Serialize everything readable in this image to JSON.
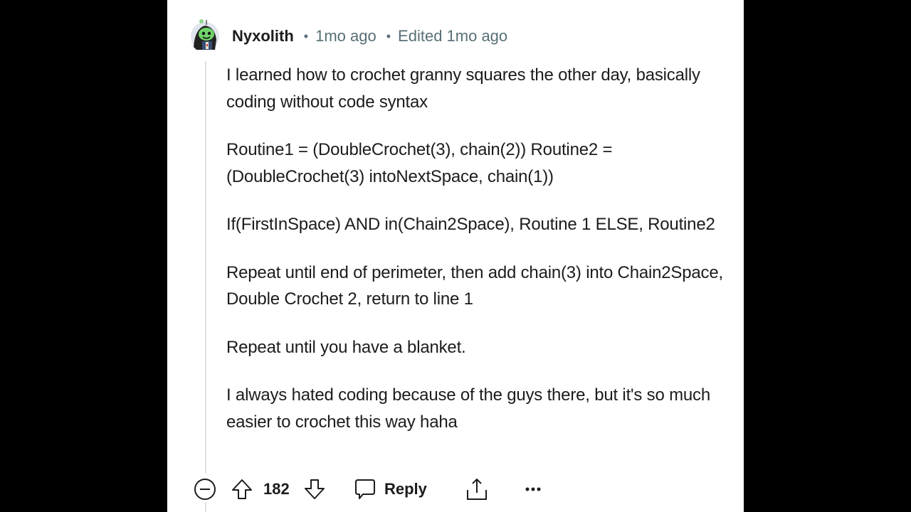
{
  "comment": {
    "author": "Nyxolith",
    "posted": "1mo ago",
    "edited": "Edited 1mo ago",
    "separator": "•",
    "avatar_icon": "snoo-avatar-icon",
    "paragraphs": [
      "I learned how to crochet granny squares the other day, basically coding without code syntax",
      "Routine1 = (DoubleCrochet(3), chain(2)) Routine2 = (DoubleCrochet(3) intoNextSpace, chain(1))",
      "If(FirstInSpace) AND in(Chain2Space), Routine 1 ELSE, Routine2",
      "Repeat until end of perimeter, then add chain(3) into Chain2Space, Double Crochet 2, return to line 1",
      "Repeat until you have a blanket.",
      "I always hated coding because of the guys there, but it's so much easier to crochet this way haha"
    ]
  },
  "actions": {
    "collapse_icon": "collapse-minus-icon",
    "upvote_icon": "upvote-arrow-icon",
    "score": "182",
    "downvote_icon": "downvote-arrow-icon",
    "reply_icon": "comment-bubble-icon",
    "reply_label": "Reply",
    "share_icon": "share-icon",
    "more_icon": "more-options-icon"
  },
  "colors": {
    "text": "#1c1c1c",
    "meta": "#576f76",
    "thread_line": "#e0e2e4",
    "avatar_green": "#6fd36a"
  }
}
